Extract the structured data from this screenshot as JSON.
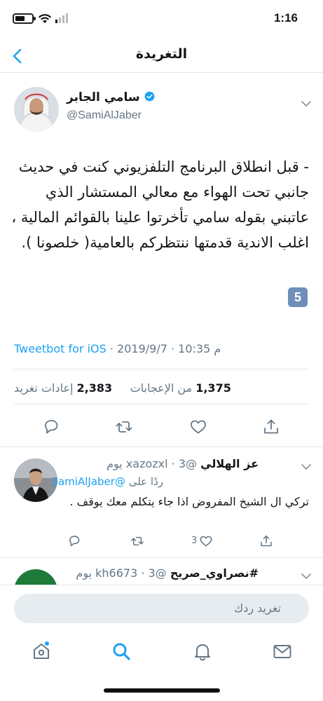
{
  "status_bar": {
    "time": "1:16"
  },
  "nav": {
    "title": "التغريدة",
    "back_icon": "chevron-left-icon"
  },
  "tweet": {
    "author_name": "سامي الجابر",
    "handle": "@SamiAlJaber",
    "text": "- قبل انطلاق البرنامج التلفزيوني كنت في حديث جانبي تحت الهواء مع معالي المستشار الذي عاتبني بقوله سامي تأخرتوا علينا بالقوائم المالية ، اغلب الاندية قدمتها ننتظركم بالعامية( خلصونا ).",
    "keycap": "5",
    "source": "Tweetbot for iOS",
    "date": "2019/9/7",
    "time": "10:35 م",
    "retweets_count": "2,383",
    "retweets_label": "إعادات تغريد",
    "likes_count": "1,375",
    "likes_label": "من الإعجابات"
  },
  "replies": [
    {
      "name": "عز الهلالي",
      "handle": "@xazozxl",
      "age": "3 يوم",
      "replying_prefix": "ردًا على",
      "replying_to": "@SamiAlJaber",
      "text": "تركي ال الشيخ المفروض اذا جاء يتكلم معك يوقف .",
      "like_count": "3"
    },
    {
      "name": "#نصراوي_صريح",
      "handle": "@kh6673",
      "age": "3 يوم"
    }
  ],
  "composer": {
    "placeholder": "تغريد ردك"
  },
  "colors": {
    "accent": "#1da1f2",
    "secondary_text": "#657786",
    "divider": "#e1e8ed",
    "verified": "#1da1f2"
  }
}
